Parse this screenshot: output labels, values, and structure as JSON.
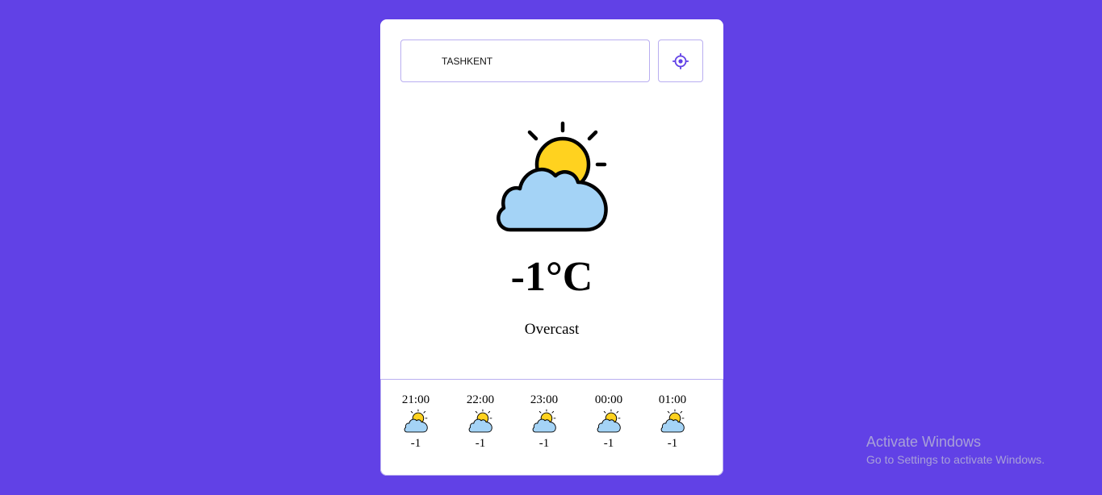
{
  "search": {
    "value": "TASHKENT",
    "placeholder": ""
  },
  "current": {
    "icon": "partly-cloudy-icon",
    "temperature": "-1°C",
    "condition": "Overcast"
  },
  "forecast": [
    {
      "time": "21:00",
      "icon": "partly-cloudy-icon",
      "temp": "-1"
    },
    {
      "time": "22:00",
      "icon": "partly-cloudy-icon",
      "temp": "-1"
    },
    {
      "time": "23:00",
      "icon": "partly-cloudy-icon",
      "temp": "-1"
    },
    {
      "time": "00:00",
      "icon": "partly-cloudy-icon",
      "temp": "-1"
    },
    {
      "time": "01:00",
      "icon": "partly-cloudy-icon",
      "temp": "-1"
    }
  ],
  "windows_watermark": {
    "title": "Activate Windows",
    "subtitle": "Go to Settings to activate Windows."
  },
  "colors": {
    "background": "#6141e6",
    "accent": "#6141e6",
    "sun": "#ffd21f",
    "cloud": "#a4d3f6"
  }
}
